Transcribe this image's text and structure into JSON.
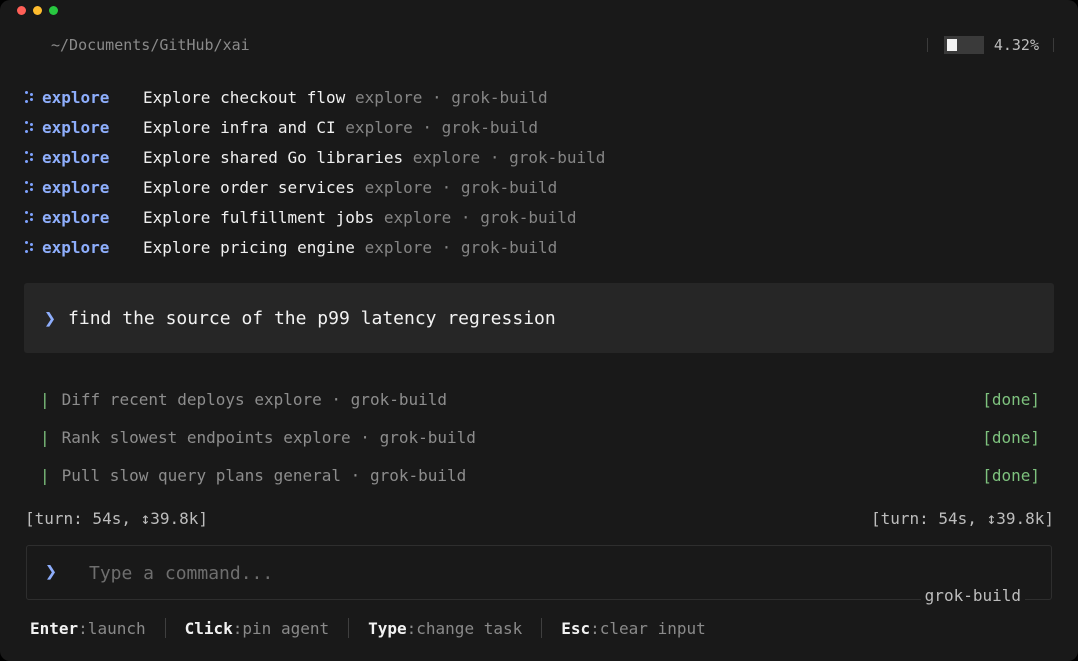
{
  "header": {
    "path": "~/Documents/GitHub/xai",
    "context_percent": "4.32%",
    "context_fraction": 0.0432
  },
  "agents": [
    {
      "tag": "explore",
      "task": "Explore checkout flow",
      "type": "explore",
      "model": "grok-build"
    },
    {
      "tag": "explore",
      "task": "Explore infra and CI",
      "type": "explore",
      "model": "grok-build"
    },
    {
      "tag": "explore",
      "task": "Explore shared Go libraries",
      "type": "explore",
      "model": "grok-build"
    },
    {
      "tag": "explore",
      "task": "Explore order services",
      "type": "explore",
      "model": "grok-build"
    },
    {
      "tag": "explore",
      "task": "Explore fulfillment jobs",
      "type": "explore",
      "model": "grok-build"
    },
    {
      "tag": "explore",
      "task": "Explore pricing engine",
      "type": "explore",
      "model": "grok-build"
    }
  ],
  "separator": "·",
  "prompt": {
    "chevron": "❯",
    "text": "find the source of the p99 latency regression"
  },
  "subtasks": [
    {
      "bar": "|",
      "name": "Diff recent deploys",
      "type": "explore",
      "model": "grok-build",
      "status": "[done]"
    },
    {
      "bar": "|",
      "name": "Rank slowest endpoints",
      "type": "explore",
      "model": "grok-build",
      "status": "[done]"
    },
    {
      "bar": "|",
      "name": "Pull slow query plans",
      "type": "general",
      "model": "grok-build",
      "status": "[done]"
    }
  ],
  "turn": {
    "left": "[turn: 54s, ↕39.8k]",
    "right": "[turn: 54s, ↕39.8k]"
  },
  "input": {
    "chevron": "❯",
    "placeholder": "Type a command...",
    "value": "",
    "model_label": "grok-build"
  },
  "hints": [
    {
      "key": "Enter",
      "desc": ":launch"
    },
    {
      "key": "Click",
      "desc": ":pin agent"
    },
    {
      "key": "Type",
      "desc": ":change task"
    },
    {
      "key": "Esc",
      "desc": ":clear input"
    }
  ],
  "colors": {
    "accent": "#8eaefc",
    "done": "#7ec27e",
    "background": "#191919"
  }
}
